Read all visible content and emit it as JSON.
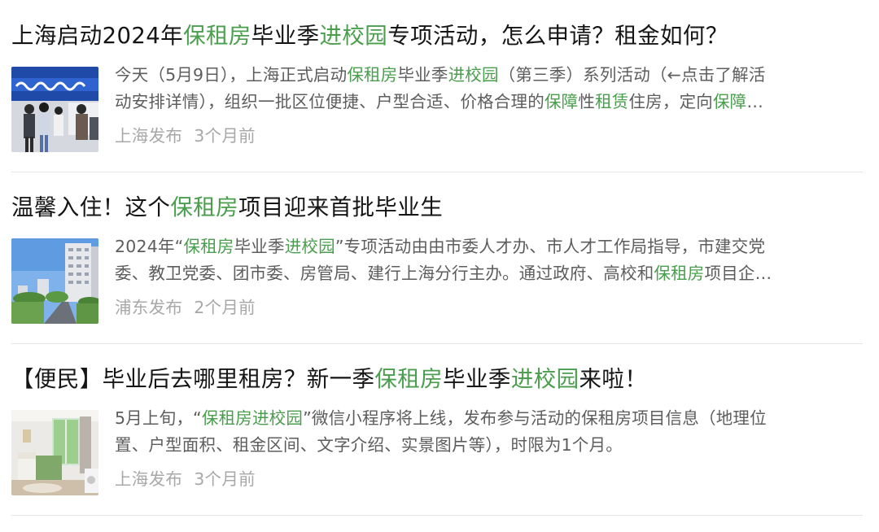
{
  "results": [
    {
      "title_parts": [
        {
          "text": "上海启动2024年",
          "hl": false
        },
        {
          "text": "保租房",
          "hl": true
        },
        {
          "text": "毕业季",
          "hl": false
        },
        {
          "text": "进校园",
          "hl": true
        },
        {
          "text": "专项活动，怎么申请？租金如何？",
          "hl": false
        }
      ],
      "desc_lines": [
        [
          {
            "text": "今天（5月9日），上海正式启动",
            "hl": false
          },
          {
            "text": "保租房",
            "hl": true
          },
          {
            "text": "毕业季",
            "hl": false
          },
          {
            "text": "进校园",
            "hl": true
          },
          {
            "text": "（第三季）系列活动（←点击了解活",
            "hl": false
          }
        ],
        [
          {
            "text": "动安排详情），组织一批区位便捷、户型合适、价格合理的",
            "hl": false
          },
          {
            "text": "保障",
            "hl": true
          },
          {
            "text": "性",
            "hl": false
          },
          {
            "text": "租赁",
            "hl": true
          },
          {
            "text": "住房，定向",
            "hl": false
          },
          {
            "text": "保障",
            "hl": true
          },
          {
            "text": "…",
            "hl": false
          }
        ]
      ],
      "source": "上海发布",
      "time": "3个月前",
      "thumb_icon": "event-photo"
    },
    {
      "title_parts": [
        {
          "text": "温馨入住！这个",
          "hl": false
        },
        {
          "text": "保租房",
          "hl": true
        },
        {
          "text": "项目迎来首批毕业生",
          "hl": false
        }
      ],
      "desc_lines": [
        [
          {
            "text": "2024年“",
            "hl": false
          },
          {
            "text": "保租房",
            "hl": true
          },
          {
            "text": "毕业季",
            "hl": false
          },
          {
            "text": "进校园",
            "hl": true
          },
          {
            "text": "”专项活动由由市委人才办、市人才工作局指导，市建交党",
            "hl": false
          }
        ],
        [
          {
            "text": "委、教卫党委、团市委、房管局、建行上海分行主办。通过政府、高校和",
            "hl": false
          },
          {
            "text": "保租房",
            "hl": true
          },
          {
            "text": "项目企…",
            "hl": false
          }
        ]
      ],
      "source": "浦东发布",
      "time": "2个月前",
      "thumb_icon": "building-photo"
    },
    {
      "title_parts": [
        {
          "text": "【便民】毕业后去哪里租房？新一季",
          "hl": false
        },
        {
          "text": "保租房",
          "hl": true
        },
        {
          "text": "毕业季",
          "hl": false
        },
        {
          "text": "进校园",
          "hl": true
        },
        {
          "text": "来啦！",
          "hl": false
        }
      ],
      "desc_lines": [
        [
          {
            "text": "5月上旬，“",
            "hl": false
          },
          {
            "text": "保租房进校园",
            "hl": true
          },
          {
            "text": "”微信小程序将上线，发布参与活动的保租房项目信息（地理位",
            "hl": false
          }
        ],
        [
          {
            "text": "置、户型面积、租金区间、文字介绍、实景图片等），时限为1个月。",
            "hl": false
          }
        ]
      ],
      "source": "上海发布",
      "time": "3个月前",
      "thumb_icon": "room-photo"
    }
  ],
  "colors": {
    "highlight": "#4a9e4d",
    "title": "#151515",
    "desc": "#5d5d5d",
    "meta": "#a8a8a8",
    "divider": "#e6e6e6"
  }
}
